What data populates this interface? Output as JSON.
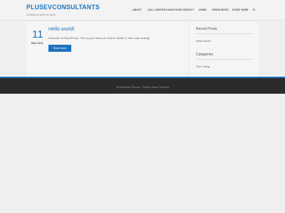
{
  "site": {
    "title": "PLUSEVCONSULTANTS",
    "tagline": "Analytical skills at work."
  },
  "nav": {
    "items": [
      "ABOUT",
      "CALL CENTER KNOW HOW",
      "CONTACT",
      "HOME",
      "RESOURCES",
      "START HERE",
      "T2"
    ]
  },
  "post": {
    "day": "11",
    "month_year": "MAY 2019",
    "title": "Hello world!",
    "excerpt": "Welcome to WordPress. This is your first post. Edit or delete it, then start writing!",
    "read_more": "Read More"
  },
  "sidebar": {
    "recent_posts_title": "Recent Posts",
    "recent_posts": [
      "Hello world!"
    ],
    "categories_title": "Categories",
    "categories": [
      "Test Categ"
    ]
  },
  "footer": {
    "text": "WordPress Theme | Tidyfor Hash Themes"
  },
  "colors": {
    "accent": "#1e73be",
    "footer_bg": "#2b2b2b",
    "page_bg": "#efefef"
  }
}
